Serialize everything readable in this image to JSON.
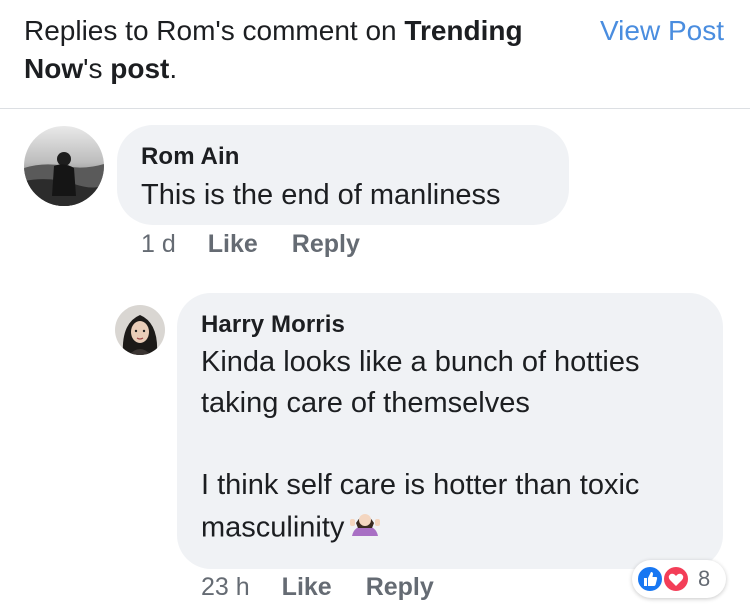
{
  "header": {
    "prefix": "Replies to Rom's comment on ",
    "page_name": "Trending Now",
    "suffix_1": "'s ",
    "post_word": "post",
    "suffix_2": ".",
    "view_post_label": "View Post"
  },
  "comments": [
    {
      "author": "Rom Ain",
      "text": "This is the end of manliness",
      "time": "1 d",
      "like_label": "Like",
      "reply_label": "Reply"
    },
    {
      "author": "Harry Morris",
      "text": "Kinda looks like a bunch of hotties\ntaking care of themselves\n\nI think self care is hotter than toxic\nmasculinity",
      "emoji": "person-shrugging-emoji",
      "time": "23 h",
      "like_label": "Like",
      "reply_label": "Reply",
      "reactions": {
        "icons": [
          "like-reaction-icon",
          "love-reaction-icon"
        ],
        "count": "8"
      }
    }
  ],
  "colors": {
    "link": "#4a8ddf",
    "bubble": "#f0f2f5",
    "meta": "#656b73",
    "like_blue": "#1877f2",
    "love_red": "#f33e58"
  }
}
